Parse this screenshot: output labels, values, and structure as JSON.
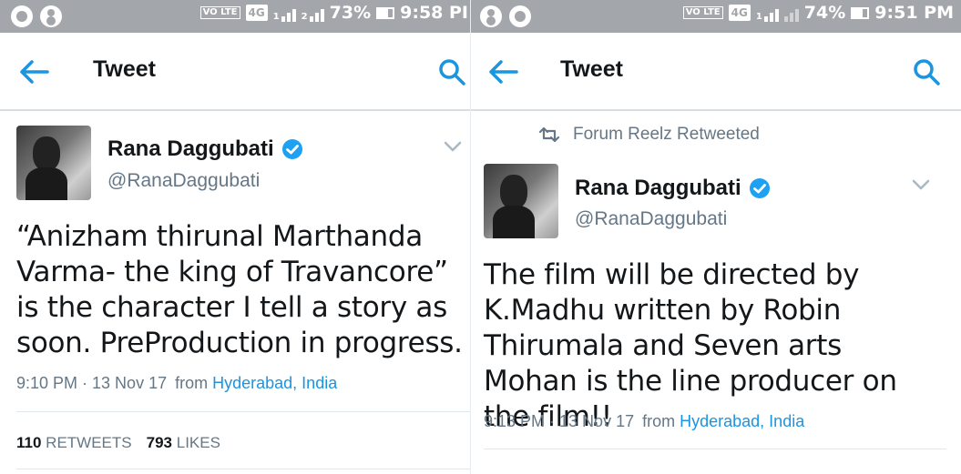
{
  "left": {
    "status": {
      "network": "4G",
      "volte": "VO LTE",
      "sim1": "1",
      "sim2": "2",
      "battery": "73%",
      "time": "9:58 PI"
    },
    "header": {
      "title": "Tweet"
    },
    "tweet": {
      "name": "Rana Daggubati",
      "handle": "@RanaDaggubati",
      "text": "“Anizham thirunal Marthanda Varma- the king of Travancore” is the character I tell a story as soon. PreProduction in progress.",
      "time": "9:10 PM · 13 Nov 17",
      "from_label": "from",
      "location": "Hyderabad, India",
      "retweets_count": "110",
      "retweets_label": "RETWEETS",
      "likes_count": "793",
      "likes_label": "LIKES"
    }
  },
  "right": {
    "status": {
      "network": "4G",
      "volte": "VO LTE",
      "sim1": "1",
      "battery": "74%",
      "time": "9:51 PM"
    },
    "header": {
      "title": "Tweet"
    },
    "retweeted_by": "Forum Reelz Retweeted",
    "tweet": {
      "name": "Rana Daggubati",
      "handle": "@RanaDaggubati",
      "text": "The film will be directed by K.Madhu written by Robin Thirumala and Seven arts Mohan is the line producer on the film!!",
      "time": "9:13 PM · 13 Nov 17",
      "from_label": "from",
      "location": "Hyderabad, India"
    }
  },
  "colors": {
    "accent": "#1b95e0",
    "statusbar": "#a3a7ab",
    "verified": "#1da1f2"
  },
  "icons": [
    "whatsapp-icon",
    "account-icon",
    "signal-icon",
    "battery-icon",
    "back-arrow-icon",
    "search-icon",
    "verified-icon",
    "chevron-down-icon",
    "retweet-icon"
  ]
}
